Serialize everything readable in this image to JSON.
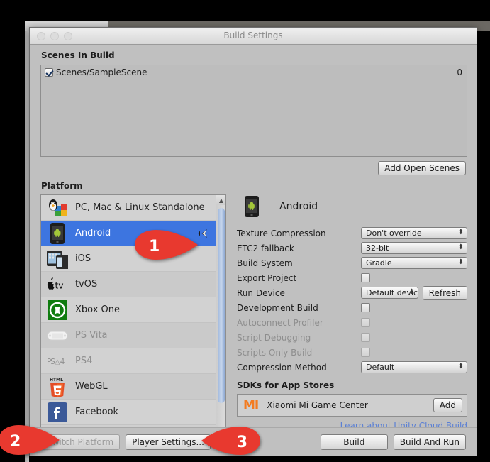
{
  "window": {
    "title": "Build Settings",
    "traffic_lights": [
      "close",
      "minimize",
      "zoom"
    ]
  },
  "scenes": {
    "section_label": "Scenes In Build",
    "items": [
      {
        "checked": true,
        "path": "Scenes/SampleScene",
        "index": "0"
      }
    ],
    "add_open_scenes_label": "Add Open Scenes"
  },
  "platform": {
    "section_label": "Platform",
    "items": [
      {
        "label": "PC, Mac & Linux Standalone",
        "icon": "standalone-icon",
        "selected": false,
        "dim": false
      },
      {
        "label": "Android",
        "icon": "android-icon",
        "selected": true,
        "dim": false,
        "unity_mark": true
      },
      {
        "label": "iOS",
        "icon": "ios-icon",
        "selected": false,
        "dim": false
      },
      {
        "label": "tvOS",
        "icon": "tvos-icon",
        "selected": false,
        "dim": false
      },
      {
        "label": "Xbox One",
        "icon": "xbox-icon",
        "selected": false,
        "dim": false
      },
      {
        "label": "PS Vita",
        "icon": "psvita-icon",
        "selected": false,
        "dim": true
      },
      {
        "label": "PS4",
        "icon": "ps4-icon",
        "selected": false,
        "dim": true
      },
      {
        "label": "WebGL",
        "icon": "webgl-icon",
        "selected": false,
        "dim": false
      },
      {
        "label": "Facebook",
        "icon": "facebook-icon",
        "selected": false,
        "dim": false
      }
    ],
    "scrollbar": {
      "up_arrow": "▲",
      "down_arrow": "▼"
    }
  },
  "details": {
    "platform_name": "Android",
    "platform_icon": "android-icon",
    "settings": [
      {
        "label": "Texture Compression",
        "type": "dropdown",
        "value": "Don't override",
        "disabled": false
      },
      {
        "label": "ETC2 fallback",
        "type": "dropdown",
        "value": "32-bit",
        "disabled": false
      },
      {
        "label": "Build System",
        "type": "dropdown",
        "value": "Gradle",
        "disabled": false
      },
      {
        "label": "Export Project",
        "type": "checkbox",
        "value": false,
        "disabled": false
      },
      {
        "label": "Run Device",
        "type": "dropdown-button",
        "value": "Default device",
        "button": "Refresh",
        "disabled": false
      },
      {
        "label": "Development Build",
        "type": "checkbox",
        "value": false,
        "disabled": false
      },
      {
        "label": "Autoconnect Profiler",
        "type": "checkbox",
        "value": false,
        "disabled": true
      },
      {
        "label": "Script Debugging",
        "type": "checkbox",
        "value": false,
        "disabled": true
      },
      {
        "label": "Scripts Only Build",
        "type": "checkbox",
        "value": false,
        "disabled": true
      },
      {
        "label": "Compression Method",
        "type": "dropdown",
        "value": "Default",
        "disabled": false
      }
    ],
    "sdk_section_label": "SDKs for App Stores",
    "sdk": {
      "logo": "MI",
      "name": "Xiaomi Mi Game Center",
      "add_label": "Add"
    },
    "cloud_build_link": "Learn about Unity Cloud Build"
  },
  "bottom_bar": {
    "switch_platform_label": "Switch Platform",
    "switch_platform_disabled": true,
    "player_settings_label": "Player Settings...",
    "build_label": "Build",
    "build_and_run_label": "Build And Run"
  },
  "callouts": [
    {
      "id": "1",
      "label": "1",
      "points": "right"
    },
    {
      "id": "2",
      "label": "2",
      "points": "right"
    },
    {
      "id": "3",
      "label": "3",
      "points": "left"
    }
  ],
  "colors": {
    "selection_blue": "#3d75e0",
    "callout_red": "#e8392f",
    "link_blue": "#5a7fd4",
    "xiaomi_orange": "#F37B20",
    "window_bg": "#c0c0c0"
  }
}
